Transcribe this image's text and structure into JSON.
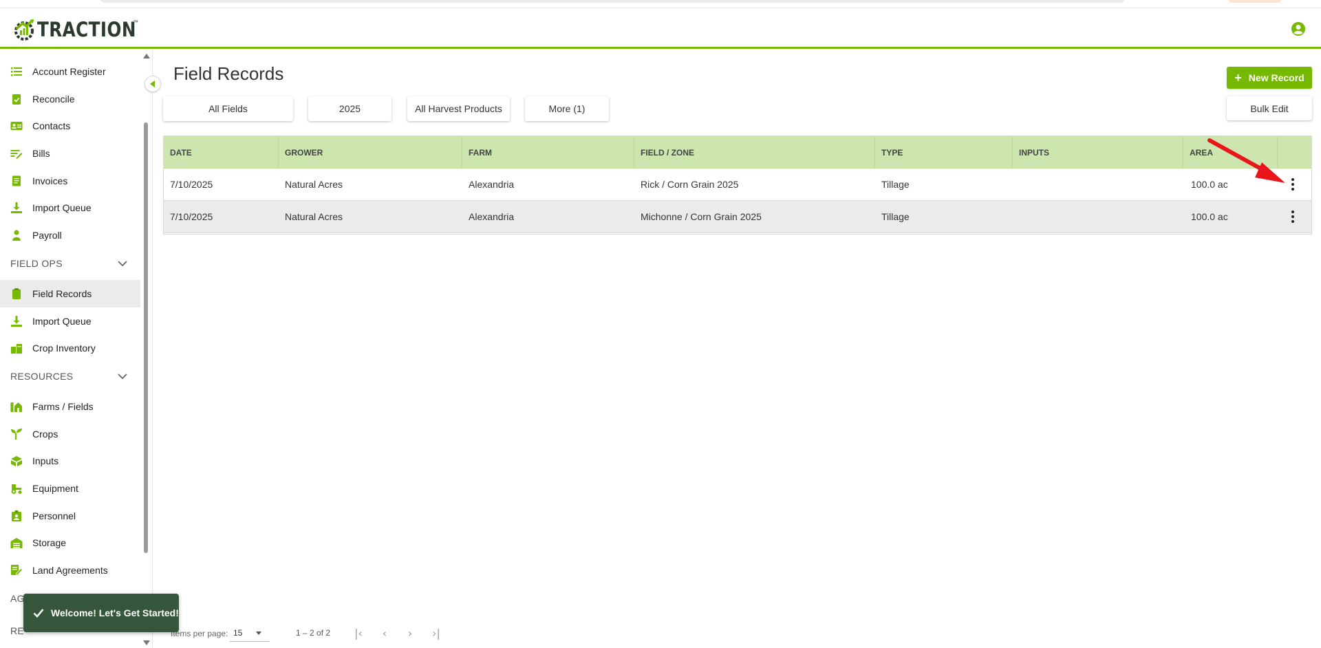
{
  "app": {
    "brand": "TRACTION",
    "brand_mark": "™",
    "brand_color": "#76b900"
  },
  "sidebar": {
    "items_top": [
      {
        "label": "Account Register",
        "icon": "list-icon"
      },
      {
        "label": "Reconcile",
        "icon": "clipboard-check-icon"
      },
      {
        "label": "Contacts",
        "icon": "contact-card-icon"
      },
      {
        "label": "Bills",
        "icon": "bill-edit-icon"
      },
      {
        "label": "Invoices",
        "icon": "invoice-icon"
      },
      {
        "label": "Import Queue",
        "icon": "download-icon"
      },
      {
        "label": "Payroll",
        "icon": "person-icon"
      }
    ],
    "section_field_ops": "FIELD OPS",
    "items_field_ops": [
      {
        "label": "Field Records",
        "icon": "clipboard-icon",
        "active": true
      },
      {
        "label": "Import Queue",
        "icon": "download-icon"
      },
      {
        "label": "Crop Inventory",
        "icon": "inventory-icon"
      }
    ],
    "section_resources": "RESOURCES",
    "items_resources": [
      {
        "label": "Farms / Fields",
        "icon": "farm-icon"
      },
      {
        "label": "Crops",
        "icon": "sprout-icon"
      },
      {
        "label": "Inputs",
        "icon": "boxes-icon"
      },
      {
        "label": "Equipment",
        "icon": "tractor-icon"
      },
      {
        "label": "Personnel",
        "icon": "badge-icon"
      },
      {
        "label": "Storage",
        "icon": "warehouse-icon"
      },
      {
        "label": "Land Agreements",
        "icon": "contract-icon"
      }
    ],
    "section_partial_1": "AG",
    "section_partial_2": "RE"
  },
  "main": {
    "title": "Field Records",
    "new_record_label": "New Record",
    "bulk_edit_label": "Bulk Edit",
    "filters": {
      "fields": "All Fields",
      "year": "2025",
      "products": "All Harvest Products",
      "more": "More (1)"
    },
    "table": {
      "columns": [
        "DATE",
        "GROWER",
        "FARM",
        "FIELD / ZONE",
        "TYPE",
        "INPUTS",
        "AREA"
      ],
      "rows": [
        {
          "date": "7/10/2025",
          "grower": "Natural Acres",
          "farm": "Alexandria",
          "field": "Rick / Corn Grain 2025",
          "type": "Tillage",
          "inputs": "",
          "area": "100.0 ac"
        },
        {
          "date": "7/10/2025",
          "grower": "Natural Acres",
          "farm": "Alexandria",
          "field": "Michonne / Corn Grain 2025",
          "type": "Tillage",
          "inputs": "",
          "area": "100.0 ac"
        }
      ]
    },
    "paginator": {
      "items_per_page_label": "Items per page:",
      "items_per_page": "15",
      "range": "1 – 2 of 2"
    }
  },
  "toast": {
    "message": "Welcome! Let's Get Started!"
  }
}
